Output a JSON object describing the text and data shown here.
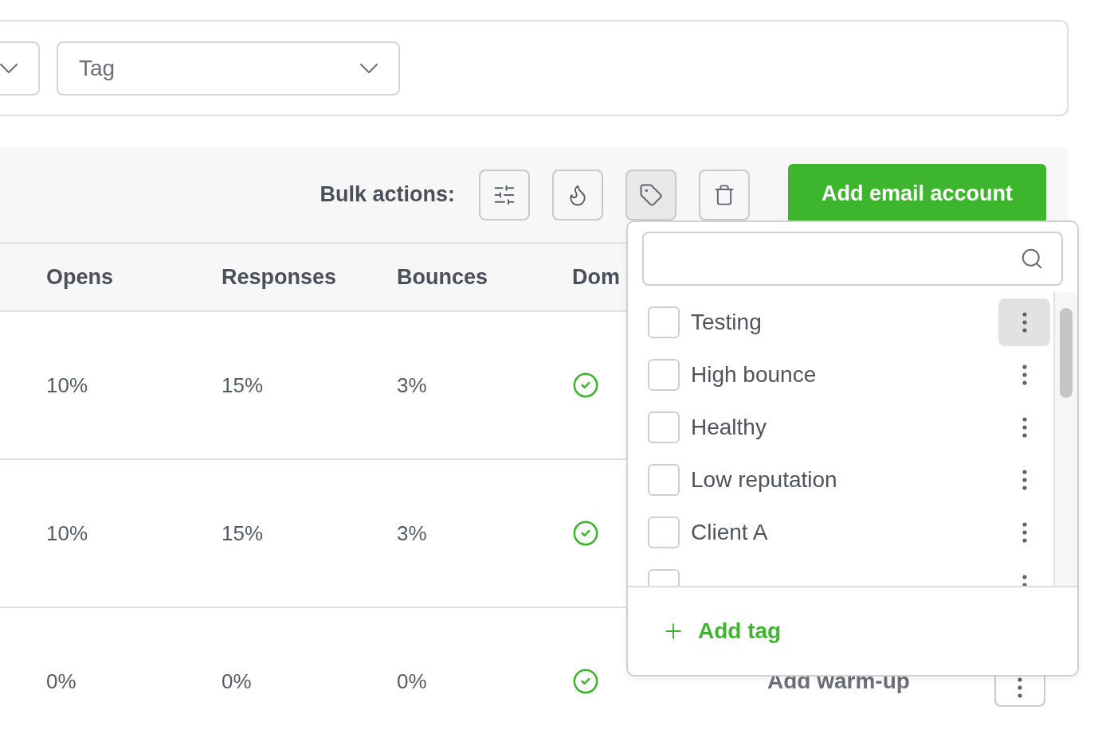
{
  "filters": [
    {
      "kind": "select"
    },
    {
      "kind": "select",
      "label": "Tag"
    }
  ],
  "bulk_actions": {
    "label": "Bulk actions:",
    "buttons": [
      {
        "kind": "sliders",
        "selected": false
      },
      {
        "kind": "flame",
        "selected": false
      },
      {
        "kind": "tag",
        "selected": true
      },
      {
        "kind": "trash",
        "selected": false
      }
    ]
  },
  "add_account_button": "Add email account",
  "table": {
    "columns": [
      "Opens",
      "Responses",
      "Bounces",
      "Dom"
    ],
    "rows": [
      {
        "cells": [
          "10%",
          "15%",
          "3%"
        ],
        "domain_ok": true
      },
      {
        "cells": [
          "10%",
          "15%",
          "3%"
        ],
        "domain_ok": true
      },
      {
        "cells": [
          "0%",
          "0%",
          "0%"
        ],
        "domain_ok": true,
        "action": "Add warm-up"
      }
    ]
  },
  "tag_menu": {
    "tags": [
      {
        "label": "Testing",
        "checked": false,
        "highlighted": true
      },
      {
        "label": "High bounce",
        "checked": false,
        "highlighted": false
      },
      {
        "label": "Healthy",
        "checked": false,
        "highlighted": false
      },
      {
        "label": "Low reputation",
        "checked": false,
        "highlighted": false
      },
      {
        "label": "Client A",
        "checked": false,
        "highlighted": false
      },
      {
        "checked": false,
        "highlighted": false
      }
    ],
    "add_label": "Add tag"
  }
}
